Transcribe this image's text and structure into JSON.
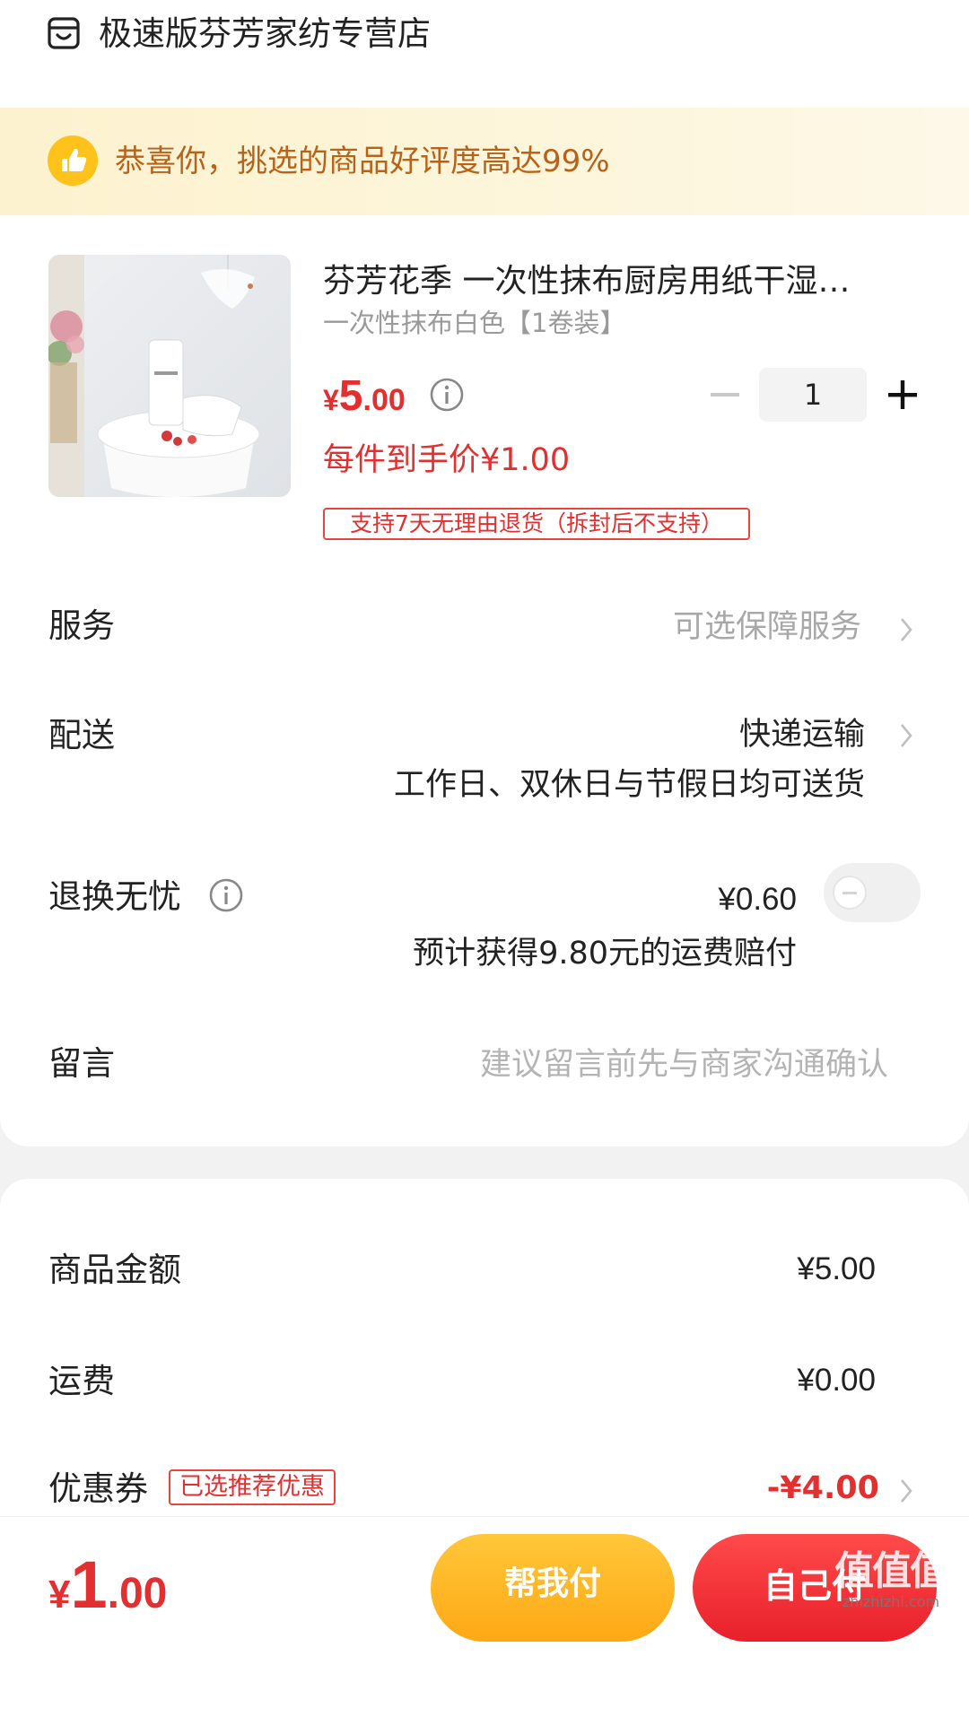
{
  "header": {
    "store_name": "极速版芬芳家纺专营店",
    "store_icon": "store-icon"
  },
  "banner": {
    "text": "恭喜你，挑选的商品好评度高达99%",
    "icon": "thumbs-up-icon"
  },
  "product": {
    "title": "芬芳花季 一次性抹布厨房用纸干湿…",
    "sku": "一次性抹布白色【1卷装】",
    "price_symbol": "¥",
    "price_integer": "5",
    "price_decimal": ".00",
    "per_item_price": "每件到手价¥1.00",
    "return_policy": "支持7天无理由退货（拆封后不支持）",
    "quantity": "1"
  },
  "rows": {
    "service_label": "服务",
    "service_value": "可选保障服务",
    "delivery_label": "配送",
    "delivery_value": "快递运输",
    "delivery_sub": "工作日、双休日与节假日均可送货",
    "return_worry_label": "退换无忧",
    "return_worry_price": "¥0.60",
    "return_worry_sub": "预计获得9.80元的运费赔付",
    "return_worry_enabled": false,
    "message_label": "留言",
    "message_placeholder": "建议留言前先与商家沟通确认"
  },
  "summary": {
    "goods_amount_label": "商品金额",
    "goods_amount_value": "¥5.00",
    "shipping_label": "运费",
    "shipping_value": "¥0.00",
    "coupon_label": "优惠券",
    "coupon_badge": "已选推荐优惠",
    "coupon_value": "-¥4.00"
  },
  "bottom": {
    "total_symbol": "¥",
    "total_integer": "1",
    "total_decimal": ".00",
    "help_pay_label": "帮我付",
    "self_pay_label": "自己付"
  },
  "watermark": {
    "big": "值值值",
    "small": "zhizhizhi.com"
  },
  "colors": {
    "accent_red": "#e32f2f",
    "banner_text": "#b8621a",
    "help_pay_yellow": "#ffb21e",
    "self_pay_red": "#ee2a32"
  }
}
